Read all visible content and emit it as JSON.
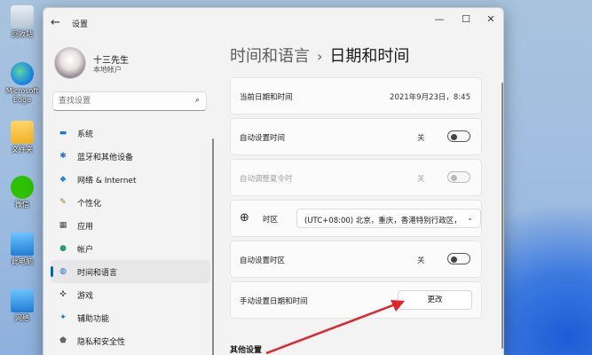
{
  "desktop": {
    "icons": [
      {
        "label": "回收站"
      },
      {
        "label": "Microsoft Edge"
      },
      {
        "label": "文件夹"
      },
      {
        "label": "微信"
      },
      {
        "label": "此电脑"
      },
      {
        "label": "网络"
      }
    ]
  },
  "window": {
    "title": "设置",
    "back_icon": "←",
    "minimize_icon": "—",
    "maximize_icon": "☐",
    "close_icon": "✕"
  },
  "user": {
    "name": "十三先生",
    "account": "本地帐户"
  },
  "search": {
    "placeholder": "查找设置",
    "icon": "⌕"
  },
  "sidebar": {
    "items": [
      {
        "label": "系统",
        "icon": "▬",
        "color": "#2a6fd1"
      },
      {
        "label": "蓝牙和其他设备",
        "icon": "✱",
        "color": "#2a6fd1"
      },
      {
        "label": "网络 & Internet",
        "icon": "◆",
        "color": "#1e88e5"
      },
      {
        "label": "个性化",
        "icon": "✎",
        "color": "#b06a2a"
      },
      {
        "label": "应用",
        "icon": "▦",
        "color": "#444444"
      },
      {
        "label": "帐户",
        "icon": "●",
        "color": "#2e9c6a"
      },
      {
        "label": "时间和语言",
        "icon": "◍",
        "color": "#2a6fd1",
        "selected": true
      },
      {
        "label": "游戏",
        "icon": "✜",
        "color": "#555555"
      },
      {
        "label": "辅助功能",
        "icon": "✦",
        "color": "#1e6fd1"
      },
      {
        "label": "隐私和安全性",
        "icon": "⬟",
        "color": "#666666"
      }
    ]
  },
  "breadcrumb": {
    "parent": "时间和语言",
    "separator": "›",
    "current": "日期和时间"
  },
  "settings": {
    "current_datetime": {
      "label": "当前日期和时间",
      "value": "2021年9月23日，8:45"
    },
    "auto_time": {
      "label": "自动设置时间",
      "state": "关"
    },
    "auto_dst": {
      "label": "自动调整夏令时",
      "state": "关"
    },
    "timezone": {
      "label": "时区",
      "icon": "⊕",
      "value": "(UTC+08:00) 北京，重庆，香港特别行政区，",
      "chevron": "⌄"
    },
    "auto_timezone": {
      "label": "自动设置时区",
      "state": "关"
    },
    "manual_datetime": {
      "label": "手动设置日期和时间",
      "button": "更改"
    }
  },
  "other_section": {
    "title": "其他设置"
  },
  "colors": {
    "accent": "#0067c0",
    "annotation_arrow": "#e0242a"
  }
}
